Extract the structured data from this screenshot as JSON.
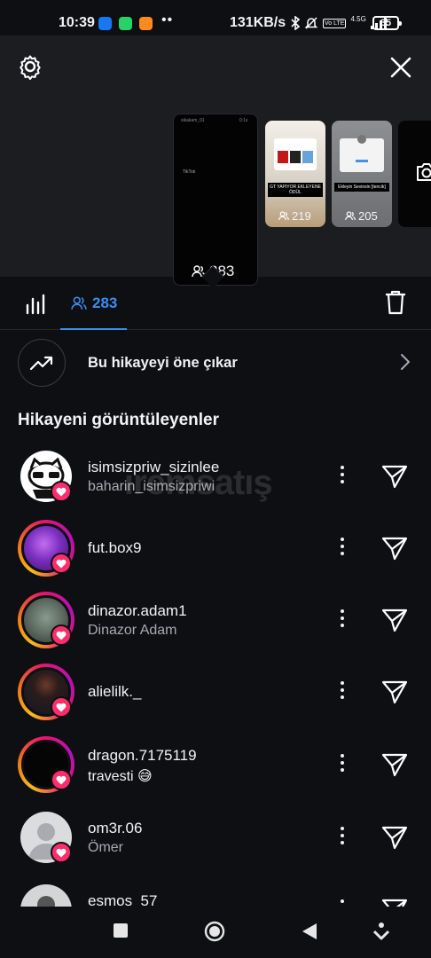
{
  "status_bar": {
    "time": "10:39",
    "dots": "••",
    "network_speed": "131KB/s",
    "network_type": "4.5G",
    "volte": "Vo LTE",
    "battery": "35"
  },
  "story_tray": {
    "main_story": {
      "header": "sikakam_01",
      "time": "0:1s",
      "watermark": "TikTok",
      "viewer_count": "283"
    },
    "thumbs": [
      {
        "label": "GT YAPIYOR EKLEYENE ÖDÜL",
        "viewer_count": "219"
      },
      {
        "label": "Ekleyin Sevinsin [tencik]",
        "viewer_count": "205"
      }
    ]
  },
  "tabs": {
    "viewers_count": "283"
  },
  "promote": {
    "label": "Bu hikayeyi öne çıkar"
  },
  "section": {
    "title": "Hikayeni görüntüleyenler"
  },
  "viewers": [
    {
      "username": "isimsizpriw_sizinlee",
      "full_name": "baharin_isimsizpriwi"
    },
    {
      "username": "fut.box9",
      "full_name": ""
    },
    {
      "username": "dinazor.adam1",
      "full_name": "Dinazor Adam"
    },
    {
      "username": "alielilk._",
      "full_name": ""
    },
    {
      "username": "dragon.7175119",
      "full_name": "travesti 😅"
    },
    {
      "username": "om3r.06",
      "full_name": "Ömer"
    },
    {
      "username": "esmos_57",
      "full_name": ""
    }
  ],
  "watermark_text": "iremsatış",
  "colors": {
    "accent": "#3b8ef0",
    "heart": "#ff2d6b",
    "background": "#0d0f12",
    "tray": "#1c1d21"
  },
  "icons": {
    "settings": "gear-icon",
    "close": "close-icon",
    "insights": "bar-chart-icon",
    "viewers": "people-icon",
    "delete": "trash-icon",
    "promote": "trending-up-icon",
    "send": "paper-plane-icon",
    "like": "heart-icon"
  }
}
